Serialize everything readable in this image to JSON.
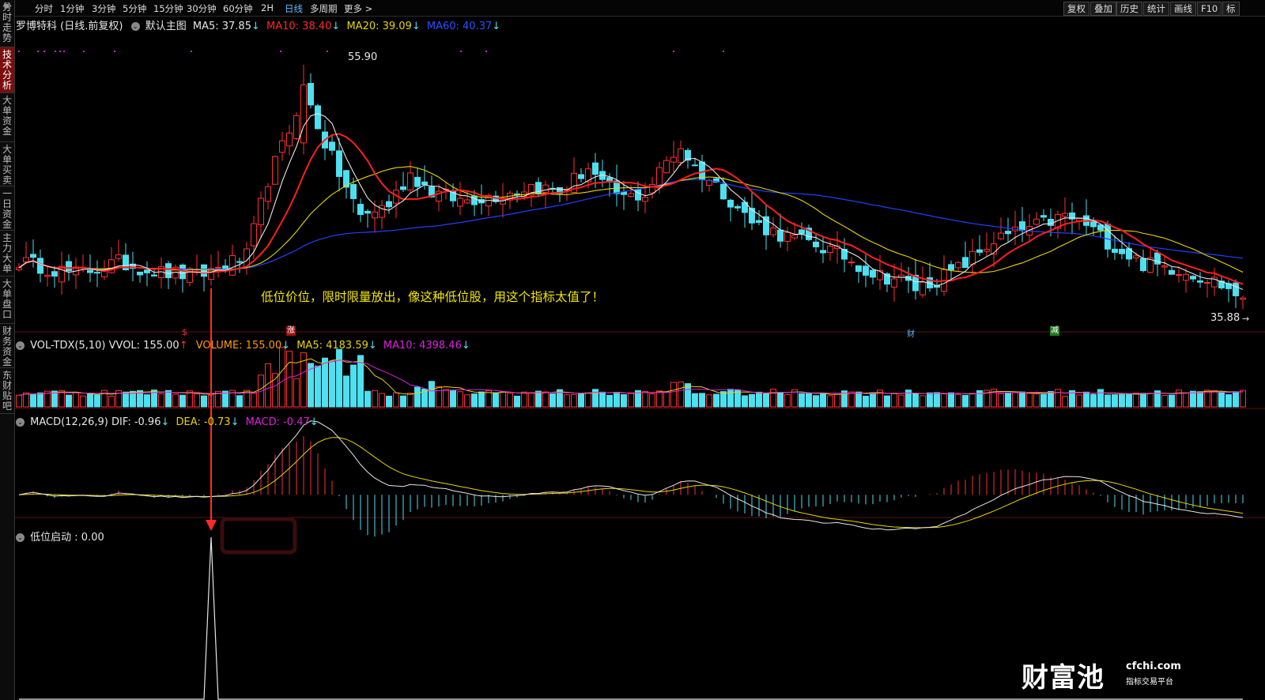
{
  "sidebar": {
    "tabs": [
      {
        "label": "分时走势",
        "active": false
      },
      {
        "label": "技术分析",
        "active": true
      },
      {
        "label": "大单资金",
        "active": false
      },
      {
        "label": "大单买卖",
        "active": false
      },
      {
        "label": "一日资金",
        "active": false
      },
      {
        "label": "主力大单",
        "active": false
      },
      {
        "label": "大单盘口",
        "active": false
      },
      {
        "label": "财务资金",
        "active": false
      },
      {
        "label": "东财贴吧",
        "active": false
      }
    ]
  },
  "toolbar": {
    "timeframes": [
      "分时",
      "1分钟",
      "3分钟",
      "5分钟",
      "15分钟",
      "30分钟",
      "60分钟",
      "2H",
      "日线",
      "多周期",
      "更多 >"
    ],
    "active_timeframe": "日线",
    "buttons": [
      "复权",
      "叠加",
      "历史",
      "统计",
      "画线",
      "F10",
      "标"
    ]
  },
  "price_panel": {
    "title": "罗博特科 (日线.前复权)",
    "template": "默认主图",
    "ma": [
      {
        "label": "MA5: 37.85",
        "arrow": "↓"
      },
      {
        "label": "MA10: 38.40",
        "arrow": "↓"
      },
      {
        "label": "MA20: 39.09",
        "arrow": "↓"
      },
      {
        "label": "MA60: 40.37",
        "arrow": "↓"
      }
    ],
    "high_label": "55.90",
    "low_label": "35.88",
    "annotation": "低位价位，限时限量放出，像这种低位股，用这个指标太值了！",
    "event_markers": [
      "$",
      "涨",
      "财",
      "减"
    ]
  },
  "volume_panel": {
    "title": "VOL-TDX(5,10)",
    "items": [
      {
        "label": "VVOL: 155.00",
        "arrow": "↑"
      },
      {
        "label": "VOLUME: 155.00",
        "arrow": "↓"
      },
      {
        "label": "MA5: 4183.59",
        "arrow": "↓"
      },
      {
        "label": "MA10: 4398.46",
        "arrow": "↓"
      }
    ]
  },
  "macd_panel": {
    "title": "MACD(12,26,9)",
    "items": [
      {
        "label": "DIF: -0.96",
        "arrow": "↓"
      },
      {
        "label": "DEA: -0.73",
        "arrow": "↓"
      },
      {
        "label": "MACD: -0.47",
        "arrow": "↓"
      }
    ]
  },
  "indicator_panel": {
    "title": "低位启动 : 0.00"
  },
  "logo": {
    "text": "财富池",
    "url": "cfchi.com",
    "subtitle": "指标交易平台"
  },
  "colors": {
    "up": "#ff3030",
    "down": "#4de0f0",
    "ma5": "#e6e6e6",
    "ma10": "#ff1e1e",
    "ma20": "#e8d400",
    "ma60": "#2040ff",
    "dea": "#e8d400",
    "vvol": "#e020e0"
  },
  "chart_data": {
    "type": "candlestick",
    "y_range": [
      35.0,
      57.0
    ],
    "anchor_closes": [
      [
        0,
        39.8
      ],
      [
        8,
        38.8
      ],
      [
        14,
        39.7
      ],
      [
        20,
        38.9
      ],
      [
        25,
        38.6
      ],
      [
        32,
        40.2
      ],
      [
        35,
        46.5
      ],
      [
        38,
        50.5
      ],
      [
        40,
        54.0
      ],
      [
        43,
        49.5
      ],
      [
        45,
        47.0
      ],
      [
        48,
        43.5
      ],
      [
        52,
        44.5
      ],
      [
        55,
        47.0
      ],
      [
        58,
        45.5
      ],
      [
        62,
        44.8
      ],
      [
        68,
        45.3
      ],
      [
        72,
        46.0
      ],
      [
        76,
        45.5
      ],
      [
        80,
        47.5
      ],
      [
        82,
        46.0
      ],
      [
        85,
        45.0
      ],
      [
        88,
        45.3
      ],
      [
        91,
        48.0
      ],
      [
        93,
        49.2
      ],
      [
        95,
        47.5
      ],
      [
        99,
        45.5
      ],
      [
        103,
        43.0
      ],
      [
        108,
        41.8
      ],
      [
        112,
        41.2
      ],
      [
        116,
        40.2
      ],
      [
        120,
        38.8
      ],
      [
        124,
        38.3
      ],
      [
        126,
        37.6
      ],
      [
        129,
        38.3
      ],
      [
        132,
        39.2
      ],
      [
        137,
        41.5
      ],
      [
        142,
        42.5
      ],
      [
        147,
        43.5
      ],
      [
        150,
        42.8
      ],
      [
        154,
        41.0
      ],
      [
        158,
        39.6
      ],
      [
        163,
        39.2
      ],
      [
        168,
        38.2
      ],
      [
        171,
        37.2
      ],
      [
        172,
        36.3
      ]
    ],
    "macd_extreme": [
      -0.99,
      3.2
    ]
  }
}
